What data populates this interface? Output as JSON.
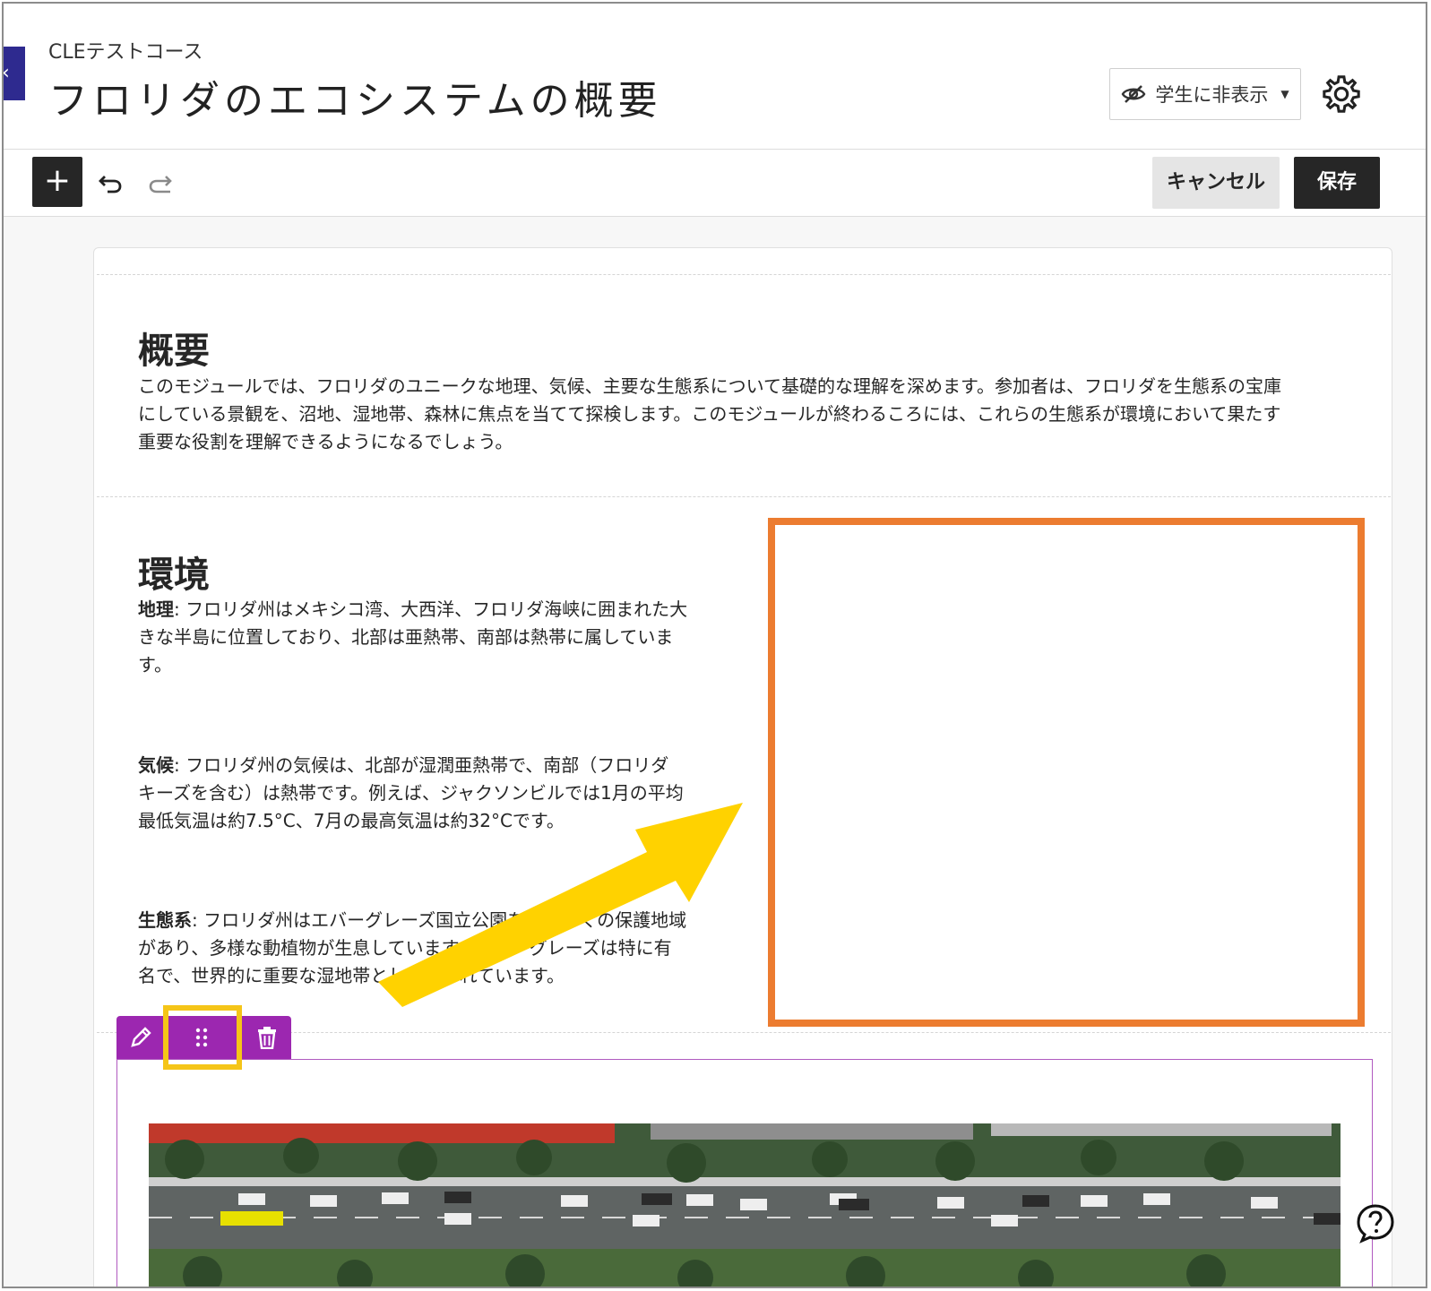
{
  "header": {
    "course_name": "CLEテストコース",
    "page_title": "フロリダのエコシステムの概要",
    "visibility_label": "学生に非表示"
  },
  "toolbar": {
    "add_label": "+",
    "cancel_label": "キャンセル",
    "save_label": "保存"
  },
  "overview": {
    "heading": "概要",
    "lines": [
      "このモジュールでは、フロリダのユニークな地理、気候、主要な生態系について基礎的な理解を深めます。参加者は、フロリダを生態系の宝庫",
      "にしている景観を、沼地、湿地帯、森林に焦点を当てて探検します。このモジュールが終わるころには、これらの生態系が環境において果たす",
      "重要な役割を理解できるようになるでしょう。"
    ]
  },
  "environment": {
    "heading": "環境",
    "geography": {
      "term": "地理",
      "lines": [
        ": フロリダ州はメキシコ湾、大西洋、フロリダ海峡に囲まれた大",
        "きな半島に位置しており、北部は亜熱帯、南部は熱帯に属していま",
        "す。"
      ]
    },
    "climate": {
      "term": "気候",
      "lines": [
        ": フロリダ州の気候は、北部が湿潤亜熱帯で、南部（フロリダ",
        "キーズを含む）は熱帯です。例えば、ジャクソンビルでは1月の平均",
        "最低気温は約7.5°C、7月の最高気温は約32°Cです。"
      ]
    },
    "ecosystem": {
      "term": "生態系",
      "lines": [
        ": フロリダ州はエバーグレーズ国立公園を含む多くの保護地域",
        "があり、多様な動植物が生息しています。エバーグレーズは特に有",
        "名で、世界的に重要な湿地帯として知られています。"
      ]
    }
  },
  "colors": {
    "accent_purple": "#9c27b0",
    "drop_target": "#ec7c30",
    "highlight": "#f5c518",
    "dark_button": "#262626"
  },
  "icons": [
    "back-icon",
    "eye-slash-icon",
    "caret-down-icon",
    "gear-icon",
    "plus-icon",
    "undo-icon",
    "redo-icon",
    "pencil-icon",
    "drag-handle-icon",
    "trash-icon",
    "help-icon"
  ]
}
